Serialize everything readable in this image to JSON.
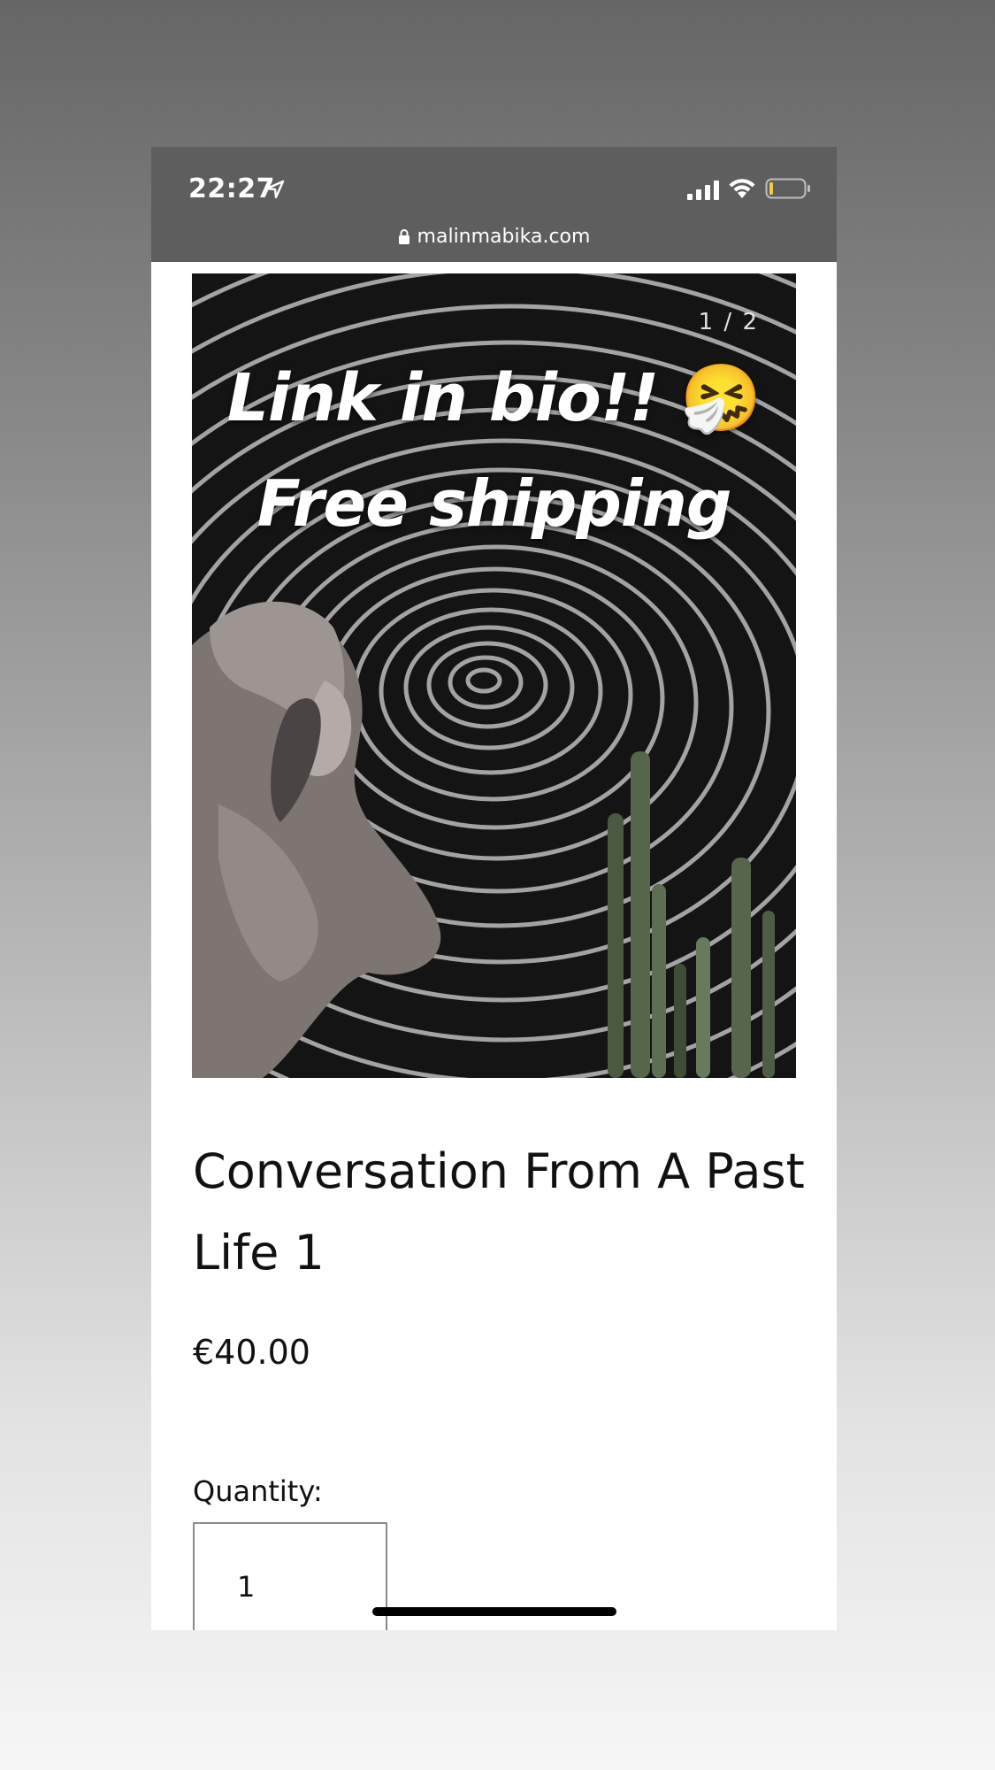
{
  "status_bar": {
    "time": "22:27",
    "url": "malinmabika.com",
    "icons": [
      "location-arrow-icon",
      "cellular-signal-icon",
      "wifi-icon",
      "battery-icon",
      "lock-icon"
    ]
  },
  "product": {
    "image_counter": "1 / 2",
    "image_text_line1": "Link in bio!!",
    "image_emoji": "🤧",
    "image_text_line2": "Free shipping",
    "title": "Conversation From A Past Life 1",
    "price": "€40.00",
    "quantity_label": "Quantity:",
    "quantity_value": "1"
  },
  "colors": {
    "status_bar_bg": "#5e5e5e",
    "page_bg": "#ffffff",
    "text": "#111111"
  }
}
